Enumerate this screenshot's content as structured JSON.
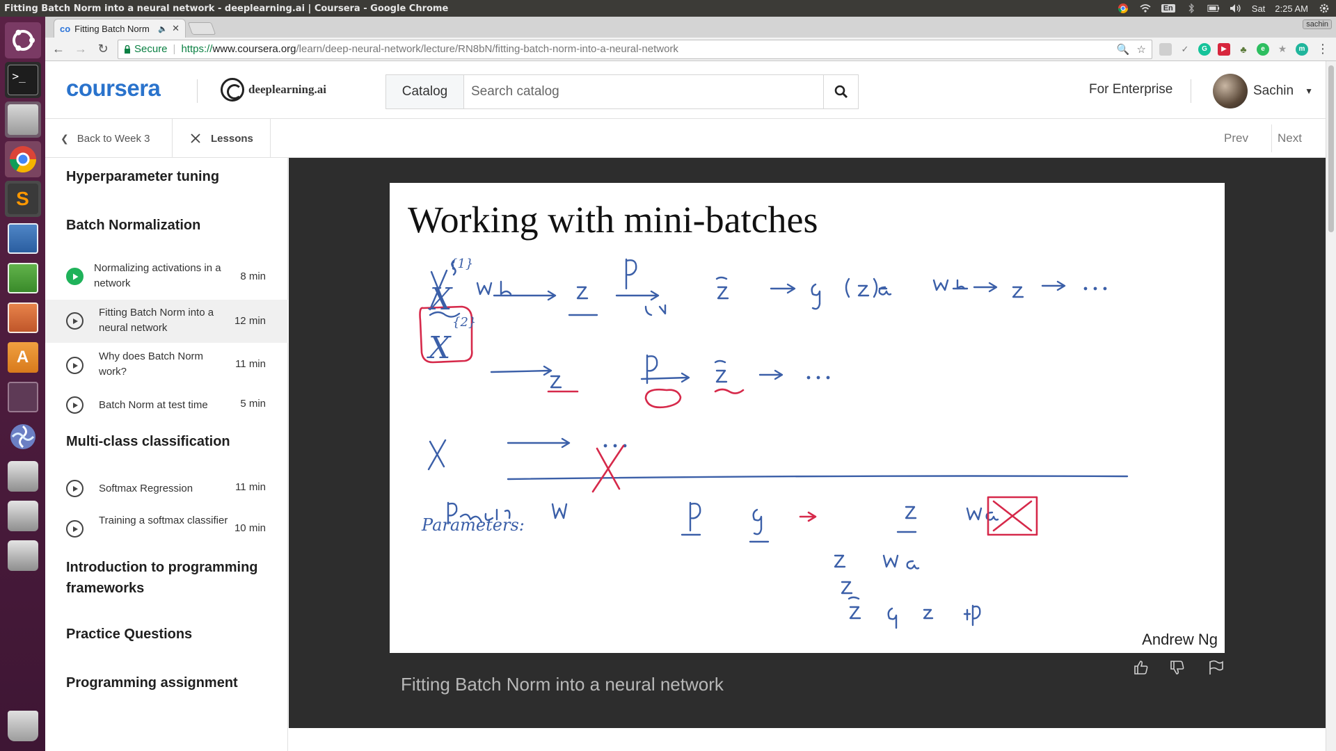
{
  "system": {
    "window_title": "Fitting Batch Norm into a neural network - deeplearning.ai | Coursera - Google Chrome",
    "lang": "En",
    "day": "Sat",
    "time": "2:25 AM"
  },
  "browser": {
    "tab_title": "Fitting Batch Norm",
    "user_badge": "sachin",
    "secure_label": "Secure",
    "url_scheme": "https://",
    "url_host": "www.coursera.org",
    "url_path": "/learn/deep-neural-network/lecture/RN8bN/fitting-batch-norm-into-a-neural-network"
  },
  "header": {
    "logo": "coursera",
    "partner": "deeplearning.ai",
    "catalog_label": "Catalog",
    "search_placeholder": "Search catalog",
    "enterprise_label": "For Enterprise",
    "user_name": "Sachin"
  },
  "subnav": {
    "back_label": "Back to Week 3",
    "lessons_label": "Lessons",
    "prev_label": "Prev",
    "next_label": "Next"
  },
  "sidebar": {
    "sections": {
      "s0": "Hyperparameter tuning",
      "s1": "Batch Normalization",
      "s2": "Multi-class classification",
      "s3": "Introduction to programming frameworks",
      "s4": "Practice Questions",
      "s5": "Programming assignment"
    },
    "lessons": [
      {
        "title": "Normalizing activations in a network",
        "duration": "8 min"
      },
      {
        "title": "Fitting Batch Norm into a neural network",
        "duration": "12 min"
      },
      {
        "title": "Why does Batch Norm work?",
        "duration": "11 min"
      },
      {
        "title": "Batch Norm at test time",
        "duration": "5 min"
      },
      {
        "title": "Softmax Regression",
        "duration": "11 min"
      },
      {
        "title": "Training a softmax classifier",
        "duration": "10 min"
      }
    ]
  },
  "player": {
    "slide_title": "Working with mini-batches",
    "slide_author": "Andrew Ng",
    "video_title": "Fitting Batch Norm into a neural network"
  },
  "colors": {
    "coursera_blue": "#2a73cc",
    "launcher": "#5a2145",
    "ink_blue": "#3b5fa8",
    "ink_red": "#d6294a",
    "active_green": "#1fb25a"
  }
}
